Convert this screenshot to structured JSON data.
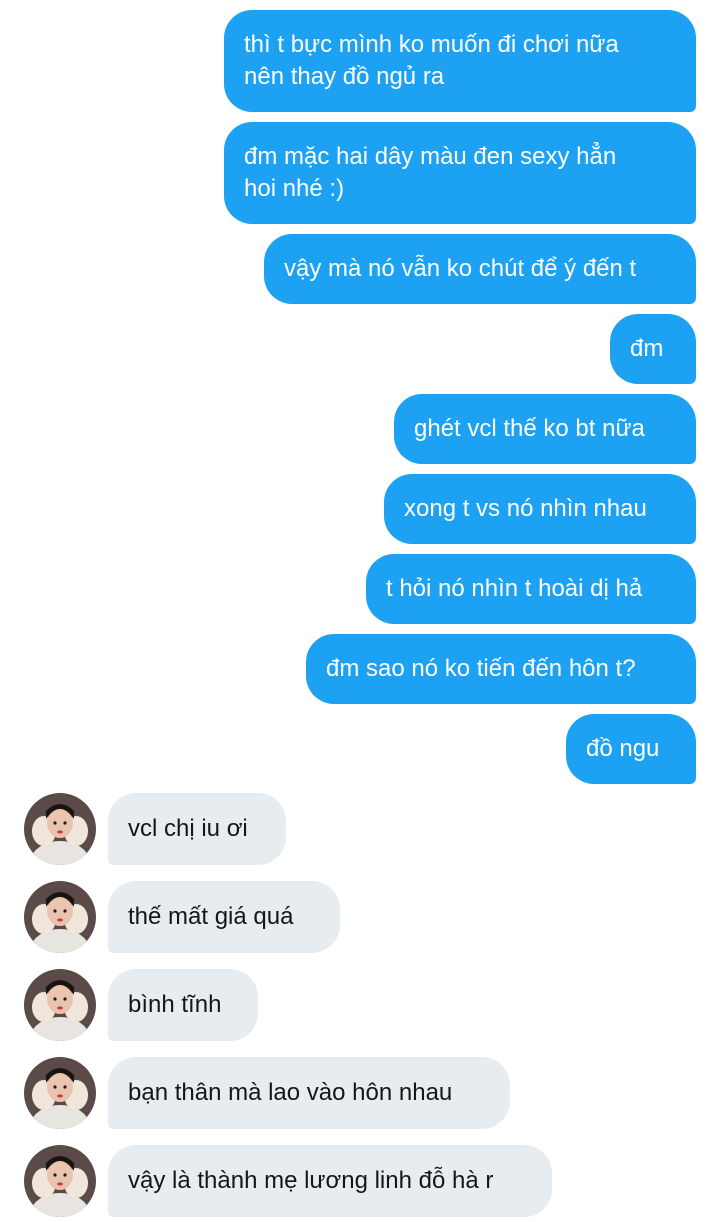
{
  "thread": {
    "outgoing": [
      "thì t bực mình ko muốn đi chơi nữa\nnên thay đồ ngủ ra",
      "đm mặc hai dây màu đen sexy hẳn\nhoi nhé :)",
      "vậy mà nó vẫn ko chút để ý đến t",
      "đm",
      "ghét vcl thế ko bt nữa",
      "xong t vs nó nhìn nhau",
      "t hỏi nó nhìn t hoài dị hả",
      "đm sao nó ko tiến đến hôn t?",
      "đồ ngu"
    ],
    "incoming": [
      "vcl chị iu ơi",
      "thế mất giá quá",
      "bình tĩnh",
      "bạn thân mà lao vào hôn nhau",
      "vậy là thành mẹ lương linh đỗ hà r"
    ]
  },
  "colors": {
    "outgoing_bubble": "#1da1f2",
    "incoming_bubble": "#e6ecf0",
    "incoming_text": "#14171a"
  },
  "icons": {
    "avatar": "profile-photo-avatar"
  }
}
